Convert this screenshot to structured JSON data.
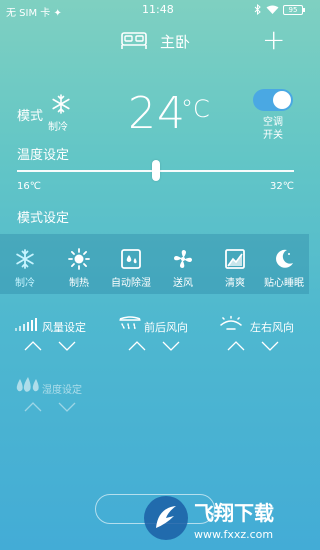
{
  "status_bar": {
    "carrier": "无 SIM 卡 ✦",
    "time": "11:48",
    "battery": "95"
  },
  "header": {
    "title": "主卧",
    "add_label": "+"
  },
  "mode": {
    "label": "模式",
    "current": "制冷"
  },
  "temperature": {
    "value": "24",
    "unit": "°C"
  },
  "power_toggle": {
    "label_line1": "空调",
    "label_line2": "开关",
    "on": true
  },
  "temp_setting": {
    "label": "温度设定",
    "min": "16℃",
    "max": "32℃",
    "level": 0.5
  },
  "mode_setting": {
    "label": "模式设定",
    "items": [
      {
        "label": "制冷"
      },
      {
        "label": "制热"
      },
      {
        "label": "自动除湿"
      },
      {
        "label": "送风"
      },
      {
        "label": "清爽"
      },
      {
        "label": "贴心睡眠"
      }
    ]
  },
  "controls": {
    "fan_label": "风量设定",
    "front_back_label": "前后风向",
    "left_right_label": "左右风向",
    "humidity_label": "湿度设定"
  },
  "watermark": {
    "brand": "飞翔下载",
    "url": "www.fxxz.com"
  },
  "colors": {
    "bg_top": "#7fd0c1",
    "bg_bottom": "#43acd6",
    "toggle_on": "#4aa8e3",
    "active_mode": "#c6f4ff"
  }
}
